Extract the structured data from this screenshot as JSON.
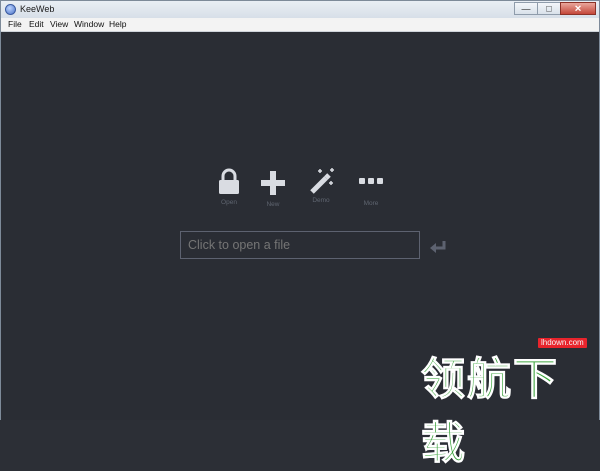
{
  "window": {
    "title": "KeeWeb"
  },
  "titlebar_controls": {
    "minimize": "—",
    "maximize": "□",
    "close": "✕"
  },
  "menu": [
    "File",
    "Edit",
    "View",
    "Window",
    "Help"
  ],
  "actions": [
    {
      "label": "Open",
      "icon": "lock-icon"
    },
    {
      "label": "New",
      "icon": "plus-icon"
    },
    {
      "label": "Demo",
      "icon": "magic-wand-icon"
    },
    {
      "label": "More",
      "icon": "more-dots-icon"
    }
  ],
  "file_input": {
    "placeholder": "Click to open a file"
  },
  "watermark": {
    "url": "lhdown.com",
    "text": "领航下载"
  },
  "colors": {
    "background": "#2a2d34",
    "icon": "#d9dce2",
    "label": "#5f6570",
    "input_border": "#5d6270",
    "watermark_green": "#3aa33a",
    "watermark_red": "#e8242c"
  }
}
